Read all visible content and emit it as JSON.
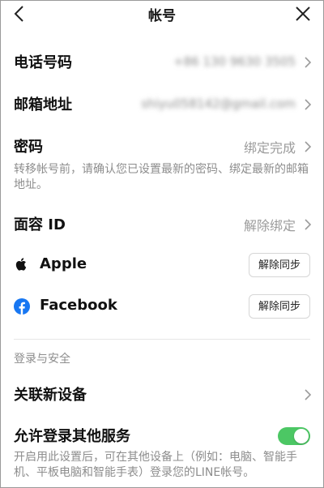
{
  "header": {
    "title": "帐号"
  },
  "rows": {
    "phone": {
      "label": "电话号码",
      "value": "+86 130 9630 3505"
    },
    "email": {
      "label": "邮箱地址",
      "value": "shiyu058142@gmail.com"
    },
    "password": {
      "label": "密码",
      "value": "绑定完成"
    },
    "password_note": "转移帐号前，请确认您已设置最新的密码、绑定最新的邮箱地址。",
    "face_id": {
      "label": "面容 ID",
      "value": "解除绑定"
    }
  },
  "linked": {
    "apple": {
      "label": "Apple",
      "button": "解除同步"
    },
    "facebook": {
      "label": "Facebook",
      "button": "解除同步"
    }
  },
  "security": {
    "section_title": "登录与安全",
    "link_device": {
      "label": "关联新设备"
    },
    "allow_login": {
      "label": "允许登录其他服务",
      "note": "开启用此设置后，可在其他设备上（例如：电脑、智能手机、平板电脑和智能手表）登录您的LINE帐号。",
      "enabled": true
    }
  },
  "colors": {
    "toggle_on": "#4cc764",
    "facebook": "#1877f2"
  }
}
